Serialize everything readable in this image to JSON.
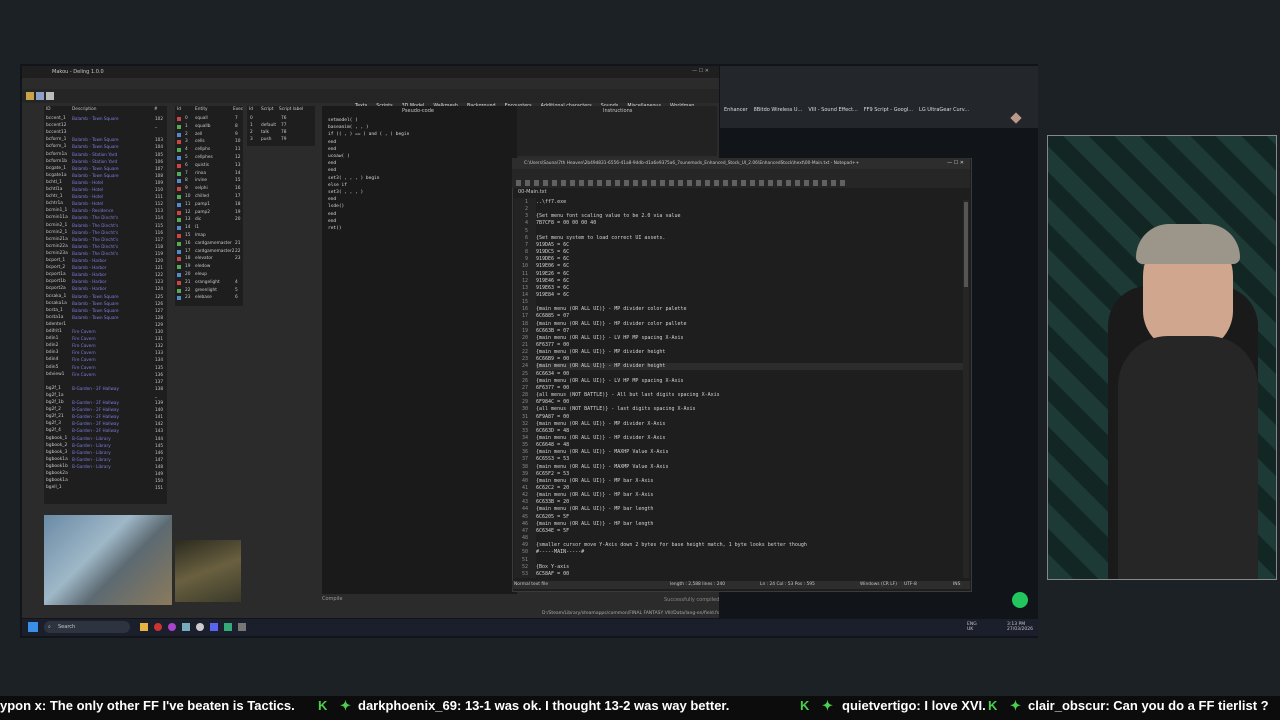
{
  "left_app": {
    "title": "Makou - Deling 1.0.0",
    "menu": [
      "File",
      "Tools",
      "Options",
      "?"
    ],
    "tabs": [
      "Texts",
      "Scripts",
      "3D Model",
      "Walkmesh",
      "Background",
      "Encounters",
      "Additional characters",
      "Sounds",
      "Miscellaneous",
      "Worldmap",
      "Import/Export"
    ],
    "field_headers": [
      "ID",
      "Description",
      "#"
    ],
    "fields": [
      [
        "bccent_1",
        "Balamb - Town Square",
        "102"
      ],
      [
        "bccent12",
        "",
        "_"
      ],
      [
        "bccent13",
        "",
        ""
      ],
      [
        "bcform_1",
        "Balamb - Town Square",
        "103"
      ],
      [
        "bcform_1",
        "Balamb - Town Square",
        "104"
      ],
      [
        "bcform1a",
        "Balamb - Station Yard",
        "105"
      ],
      [
        "bcform1b",
        "Balamb - Station Yard",
        "106"
      ],
      [
        "bcgate_1",
        "Balamb - Town Square",
        "107"
      ],
      [
        "bcgate1a",
        "Balamb - Town Square",
        "108"
      ],
      [
        "bchtl_1",
        "Balamb - Hotel",
        "109"
      ],
      [
        "bchtl1a",
        "Balamb - Hotel",
        "110"
      ],
      [
        "bchtr_1",
        "Balamb - Hotel",
        "111"
      ],
      [
        "bchtr1a",
        "Balamb - Hotel",
        "112"
      ],
      [
        "bcmin1_1",
        "Balamb - Residence",
        "113"
      ],
      [
        "bcmin11a",
        "Balamb - The Dincht's",
        "114"
      ],
      [
        "bcmin2_1",
        "Balamb - The Dincht's",
        "115"
      ],
      [
        "bcmin2_1",
        "Balamb - The Dincht's",
        "116"
      ],
      [
        "bcmin21a",
        "Balamb - The Dincht's",
        "117"
      ],
      [
        "bcmin22a",
        "Balamb - The Dincht's",
        "118"
      ],
      [
        "bcmin23a",
        "Balamb - The Dincht's",
        "119"
      ],
      [
        "bcport_1",
        "Balamb - Harbor",
        "120"
      ],
      [
        "bcport_2",
        "Balamb - Harbor",
        "121"
      ],
      [
        "bcport1a",
        "Balamb - Harbor",
        "122"
      ],
      [
        "bcport1b",
        "Balamb - Harbor",
        "123"
      ],
      [
        "bcport2a",
        "Balamb - Harbor",
        "124"
      ],
      [
        "bcsaka_1",
        "Balamb - Town Square",
        "125"
      ],
      [
        "bcsaka1a",
        "Balamb - Town Square",
        "126"
      ],
      [
        "bcsta_1",
        "Balamb - Town Square",
        "127"
      ],
      [
        "bcsta1a",
        "Balamb - Town Square",
        "128"
      ],
      [
        "bdenter1",
        "",
        "129"
      ],
      [
        "bdifrit1",
        "Fire Cavern",
        "130"
      ],
      [
        "bdin1",
        "Fire Cavern",
        "131"
      ],
      [
        "bdin2",
        "Fire Cavern",
        "132"
      ],
      [
        "bdin3",
        "Fire Cavern",
        "133"
      ],
      [
        "bdin4",
        "Fire Cavern",
        "134"
      ],
      [
        "bdin5",
        "Fire Cavern",
        "135"
      ],
      [
        "bdview1",
        "Fire Cavern",
        "136"
      ],
      [
        "",
        "",
        "137"
      ],
      [
        "bg2f_1",
        "B-Garden - 2F Hallway",
        "138"
      ],
      [
        "bg2f_1a",
        "",
        "_"
      ],
      [
        "bg2f_1b",
        "B-Garden - 2F Hallway",
        "139"
      ],
      [
        "bg2f_2",
        "B-Garden - 2F Hallway",
        "140"
      ],
      [
        "bg2f_21",
        "B-Garden - 2F Hallway",
        "141"
      ],
      [
        "bg2f_3",
        "B-Garden - 2F Hallway",
        "142"
      ],
      [
        "bg2f_4",
        "B-Garden - 2F Hallway",
        "143"
      ],
      [
        "bgbook_1",
        "B-Garden - Library",
        "144"
      ],
      [
        "bgbook_2",
        "B-Garden - Library",
        "145"
      ],
      [
        "bgbook_3",
        "B-Garden - Library",
        "146"
      ],
      [
        "bgbook1a",
        "B-Garden - Library",
        "147"
      ],
      [
        "bgbook1b",
        "B-Garden - Library",
        "148"
      ],
      [
        "bgbook2a",
        "",
        "149"
      ],
      [
        "bgbook1a",
        "",
        "150"
      ],
      [
        "bgell_1",
        "",
        "151"
      ]
    ],
    "entity_headers": [
      "Id",
      "Entity",
      "Exec"
    ],
    "entities": [
      [
        "0",
        "squall",
        "7"
      ],
      [
        "1",
        "squallb",
        "8"
      ],
      [
        "2",
        "zell",
        "9"
      ],
      [
        "3",
        "cells",
        "10"
      ],
      [
        "4",
        "cellphs",
        "11"
      ],
      [
        "5",
        "cellphes",
        "12"
      ],
      [
        "6",
        "quistis",
        "13"
      ],
      [
        "7",
        "rinoa",
        "14"
      ],
      [
        "8",
        "irvine",
        "15"
      ],
      [
        "9",
        "selphi",
        "16"
      ],
      [
        "10",
        "chilled",
        "17"
      ],
      [
        "11",
        "pamp1",
        "18"
      ],
      [
        "12",
        "pamp2",
        "19"
      ],
      [
        "13",
        "dic",
        "20"
      ],
      [
        "14",
        "l1",
        "",
        ""
      ],
      [
        "15",
        "lmap",
        ""
      ],
      [
        "16",
        "cardgamemaster",
        "21"
      ],
      [
        "17",
        "cardgamemaster2",
        "22"
      ],
      [
        "18",
        "elevator",
        "23"
      ],
      [
        "19",
        "eledow",
        ""
      ],
      [
        "20",
        "eleup",
        ""
      ],
      [
        "21",
        "orangelight",
        "4"
      ],
      [
        "22",
        "greenlight",
        "5"
      ],
      [
        "23",
        "elebase",
        "6"
      ]
    ],
    "script_headers": [
      "Id",
      "Script",
      "Script label"
    ],
    "scripts": [
      [
        "0",
        "",
        "76"
      ],
      [
        "1",
        "default",
        "77"
      ],
      [
        "2",
        "talk",
        "78"
      ],
      [
        "3",
        "push",
        "79"
      ]
    ],
    "pseudo_label": "Pseudo-code",
    "instr_label": "Instructions",
    "pseudo_lines": [
      "setmodel( )",
      "baseanim( , , )",
      "if (( , ) == ) and ( , ) begin",
      "end",
      "end",
      "ucoaw( )",
      "end",
      "end",
      "set3( , , , ) begin",
      "else if",
      "set3( , , , )",
      "end",
      "lsde()",
      "end",
      "end",
      "ret()"
    ],
    "compile_label": "Compile",
    "compiled_status": "Successfully compiled",
    "path": "D:/Steam/Library/steamapps/common/FINAL FANTASY VIII/Data/lang-en/field.fs"
  },
  "browser": {
    "bookmarks": [
      "Enhancer",
      "8Bitdo Wireless U...",
      "VIII - Sound Effect...",
      "FF9 Script - Googl...",
      "LG UltraGear Curv..."
    ]
  },
  "notepad": {
    "title": "C:\\Users\\Sauna\\7th Heaven\\2b49d831-6556-41a8-9ddb-d1a6e9375a6_7sunemods_Enhanced_Stock_UI_2.06\\EnhancedStock\\hext\\00-Main.txt - Notepad++",
    "menu": [
      "File",
      "Edit",
      "Search",
      "View",
      "Encoding",
      "Language",
      "Settings",
      "Tools",
      "Macro",
      "Run",
      "Plugins",
      "Window",
      "?"
    ],
    "tab_label": "00-Main.txt",
    "lines": [
      "..\\ff7.exe",
      "",
      "{Set menu font scaling value to be 2.0 via value",
      "7B7CF8 = 00 00 00 40",
      "",
      "{Set menu system to load correct UI assets.",
      "919DA5 = 6C",
      "919DC5 = 6C",
      "919DE6 = 6C",
      "919E06 = 6C",
      "919E26 = 6C",
      "919E46 = 6C",
      "919E63 = 6C",
      "919E84 = 6C",
      "",
      "{main menu (OR ALL UI)} - MP divider color palette",
      "6C6885 = 07",
      "{main menu (OR ALL UI)} - HP divider color pallete",
      "6C663B = 07",
      "{main menu (OR ALL UI)} - LV HP MP spacing X-Axis",
      "6F6377 = 00",
      "{main menu (OR ALL UI)} - MP divider height",
      "6C66B9 = 00",
      "{main menu (OR ALL UI)} - HP divider height",
      "6C6634 = 00",
      "{main menu (OR ALL UI)} - LV HP MP spacing X-Axis",
      "6F6377 = 00",
      "{all menus (NOT BATTLE)} - All but last digits spacing X-Axis",
      "6F984C = 00",
      "{all menus (NOT BATTLE)} - last digits spacing X-Axis",
      "6F9A87 = 00",
      "{main menu (OR ALL UI)} - MP divider X-Axis",
      "6C663D = 48",
      "{main menu (OR ALL UI)} - HP divider X-Axis",
      "6C6648 = 48",
      "{main menu (OR ALL UI)} - MAXHP Value X-Axis",
      "6C65S3 = 53",
      "{main menu (OR ALL UI)} - MAXMP Value X-Axis",
      "6C65F2 = 53",
      "{main menu (OR ALL UI)} - MP bar X-Axis",
      "6C62C2 = 20",
      "{main menu (OR ALL UI)} - HP bar X-Axis",
      "6C633B = 20",
      "{main menu (OR ALL UI)} - MP bar length",
      "6C6205 = 5F",
      "{main menu (OR ALL UI)} - HP bar length",
      "6C634E = 5F",
      "",
      "{smaller cursor move Y-Axis down 2 bytes for base height match, 1 byte looks better though",
      "#-----MAIN-----#",
      "",
      "{Box Y-axis",
      "6C58AF = 00"
    ],
    "status_left": "Normal text file",
    "status_length": "length : 2,588   lines : 240",
    "status_pos": "Ln : 24   Col : 53   Pos : 595",
    "status_eol": "Windows (CR LF)",
    "status_enc": "UTF-8",
    "status_ins": "INS"
  },
  "taskbar": {
    "search_placeholder": "Search",
    "lang": "ENG",
    "lang2": "UK",
    "time": "3:13 PM",
    "date": "27/03/2026"
  },
  "chat": {
    "messages": [
      {
        "user": "ypon x",
        "text": "The only other FF I've beaten is Tactics."
      },
      {
        "user": "darkphoenix_69",
        "text": "13-1 was ok. I thought 13-2 was way better."
      },
      {
        "user": "quietvertigo",
        "text": "I love XVI."
      },
      {
        "user": "clair_obscur",
        "text": "Can you do a FF tierlist ?"
      }
    ],
    "colors": {
      "green": "#53fc18",
      "bg": "#0c0c0c"
    }
  }
}
